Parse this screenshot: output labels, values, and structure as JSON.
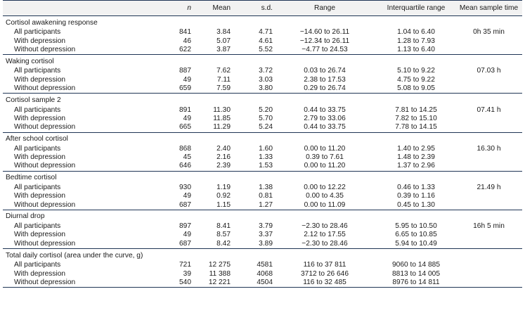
{
  "columns": [
    "n",
    "Mean",
    "s.d.",
    "Range",
    "Interquartile range",
    "Mean sample time"
  ],
  "sections": [
    {
      "title": "Cortisol awakening response",
      "time": "0h 35 min",
      "rows": [
        {
          "label": "All participants",
          "n": "841",
          "mean": "3.84",
          "sd": "4.71",
          "range": "−14.60 to 26.11",
          "iqr": "1.04 to 6.40"
        },
        {
          "label": "With depression",
          "n": "46",
          "mean": "5.07",
          "sd": "4.61",
          "range": "−12.34 to 26.11",
          "iqr": "1.28 to 7.93"
        },
        {
          "label": "Without depression",
          "n": "622",
          "mean": "3.87",
          "sd": "5.52",
          "range": "−4.77 to 24.53",
          "iqr": "1.13 to 6.40"
        }
      ]
    },
    {
      "title": "Waking cortisol",
      "time": "07.03 h",
      "rows": [
        {
          "label": "All participants",
          "n": "887",
          "mean": "7.62",
          "sd": "3.72",
          "range": "0.03 to 26.74",
          "iqr": "5.10 to 9.22"
        },
        {
          "label": "With depression",
          "n": "49",
          "mean": "7.11",
          "sd": "3.03",
          "range": "2.38 to 17.53",
          "iqr": "4.75 to 9.22"
        },
        {
          "label": "Without depression",
          "n": "659",
          "mean": "7.59",
          "sd": "3.80",
          "range": "0.29 to 26.74",
          "iqr": "5.08 to 9.05"
        }
      ]
    },
    {
      "title": "Cortisol sample 2",
      "time": "07.41 h",
      "rows": [
        {
          "label": "All participants",
          "n": "891",
          "mean": "11.30",
          "sd": "5.20",
          "range": "0.44 to 33.75",
          "iqr": "7.81 to 14.25"
        },
        {
          "label": "With depression",
          "n": "49",
          "mean": "11.85",
          "sd": "5.70",
          "range": "2.79 to 33.06",
          "iqr": "7.82 to 15.10"
        },
        {
          "label": "Without depression",
          "n": "665",
          "mean": "11.29",
          "sd": "5.24",
          "range": "0.44 to 33.75",
          "iqr": "7.78 to 14.15"
        }
      ]
    },
    {
      "title": "After school cortisol",
      "time": "16.30 h",
      "rows": [
        {
          "label": "All participants",
          "n": "868",
          "mean": "2.40",
          "sd": "1.60",
          "range": "0.00 to 11.20",
          "iqr": "1.40 to 2.95"
        },
        {
          "label": "With depression",
          "n": "45",
          "mean": "2.16",
          "sd": "1.33",
          "range": "0.39 to 7.61",
          "iqr": "1.48 to 2.39"
        },
        {
          "label": "Without depression",
          "n": "646",
          "mean": "2.39",
          "sd": "1.53",
          "range": "0.00 to 11.20",
          "iqr": "1.37 to 2.96"
        }
      ]
    },
    {
      "title": "Bedtime cortisol",
      "time": "21.49 h",
      "rows": [
        {
          "label": "All participants",
          "n": "930",
          "mean": "1.19",
          "sd": "1.38",
          "range": "0.00 to 12.22",
          "iqr": "0.46 to 1.33"
        },
        {
          "label": "With depression",
          "n": "49",
          "mean": "0.92",
          "sd": "0.81",
          "range": "0.00 to 4.35",
          "iqr": "0.39 to 1.16"
        },
        {
          "label": "Without depression",
          "n": "687",
          "mean": "1.15",
          "sd": "1.27",
          "range": "0.00 to 11.09",
          "iqr": "0.45 to 1.30"
        }
      ]
    },
    {
      "title": "Diurnal drop",
      "time": "16h 5 min",
      "rows": [
        {
          "label": "All participants",
          "n": "897",
          "mean": "8.41",
          "sd": "3.79",
          "range": "−2.30 to 28.46",
          "iqr": "5.95 to 10.50"
        },
        {
          "label": "With depression",
          "n": "49",
          "mean": "8.57",
          "sd": "3.37",
          "range": "2.12 to 17.55",
          "iqr": "6.65 to 10.85"
        },
        {
          "label": "Without depression",
          "n": "687",
          "mean": "8.42",
          "sd": "3.89",
          "range": "−2.30 to 28.46",
          "iqr": "5.94 to 10.49"
        }
      ]
    },
    {
      "title": "Total daily cortisol (area under the curve, g)",
      "time": "",
      "rows": [
        {
          "label": "All participants",
          "n": "721",
          "mean": "12 275",
          "sd": "4581",
          "range": "116 to 37 811",
          "iqr": "9060 to 14 885"
        },
        {
          "label": "With depression",
          "n": "39",
          "mean": "11 388",
          "sd": "4068",
          "range": "3712 to 26 646",
          "iqr": "8813 to 14 005"
        },
        {
          "label": "Without depression",
          "n": "540",
          "mean": "12 221",
          "sd": "4504",
          "range": "116 to 32 485",
          "iqr": "8976 to 14 811"
        }
      ]
    }
  ]
}
